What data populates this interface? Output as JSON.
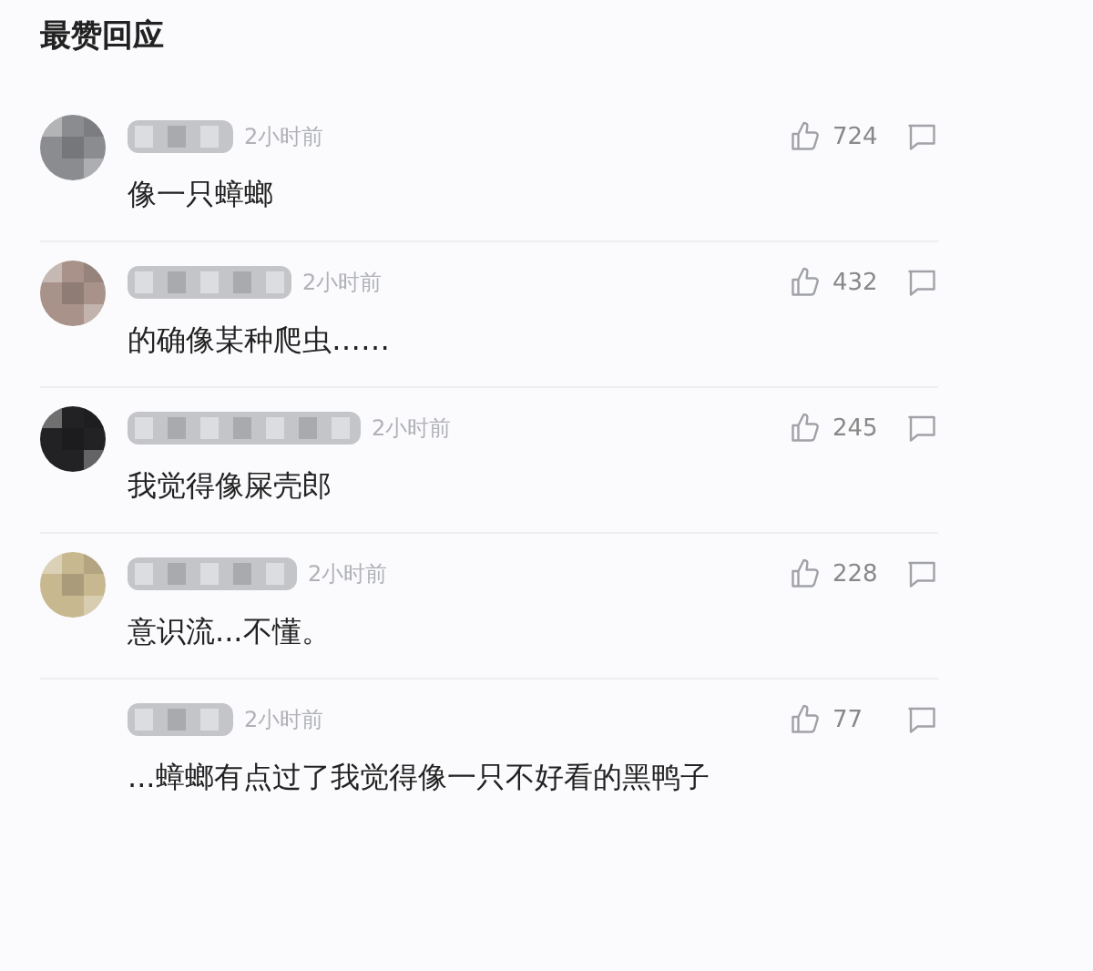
{
  "title": "最赞回应",
  "comments": [
    {
      "color": "#8a8c90",
      "time": "2小时前",
      "likes": "724",
      "text": "像一只蟑螂"
    },
    {
      "color": "#a8928a",
      "time": "2小时前",
      "likes": "432",
      "text": "的确像某种爬虫……"
    },
    {
      "color": "#222224",
      "time": "2小时前",
      "likes": "245",
      "text": "我觉得像屎壳郎"
    },
    {
      "color": "#c8b890",
      "time": "2小时前",
      "likes": "228",
      "text": "意识流...不懂。"
    },
    {
      "time": "2小时前",
      "likes": "77",
      "text": "...蟑螂有点过了我觉得像一只不好看的黑鸭子"
    }
  ]
}
